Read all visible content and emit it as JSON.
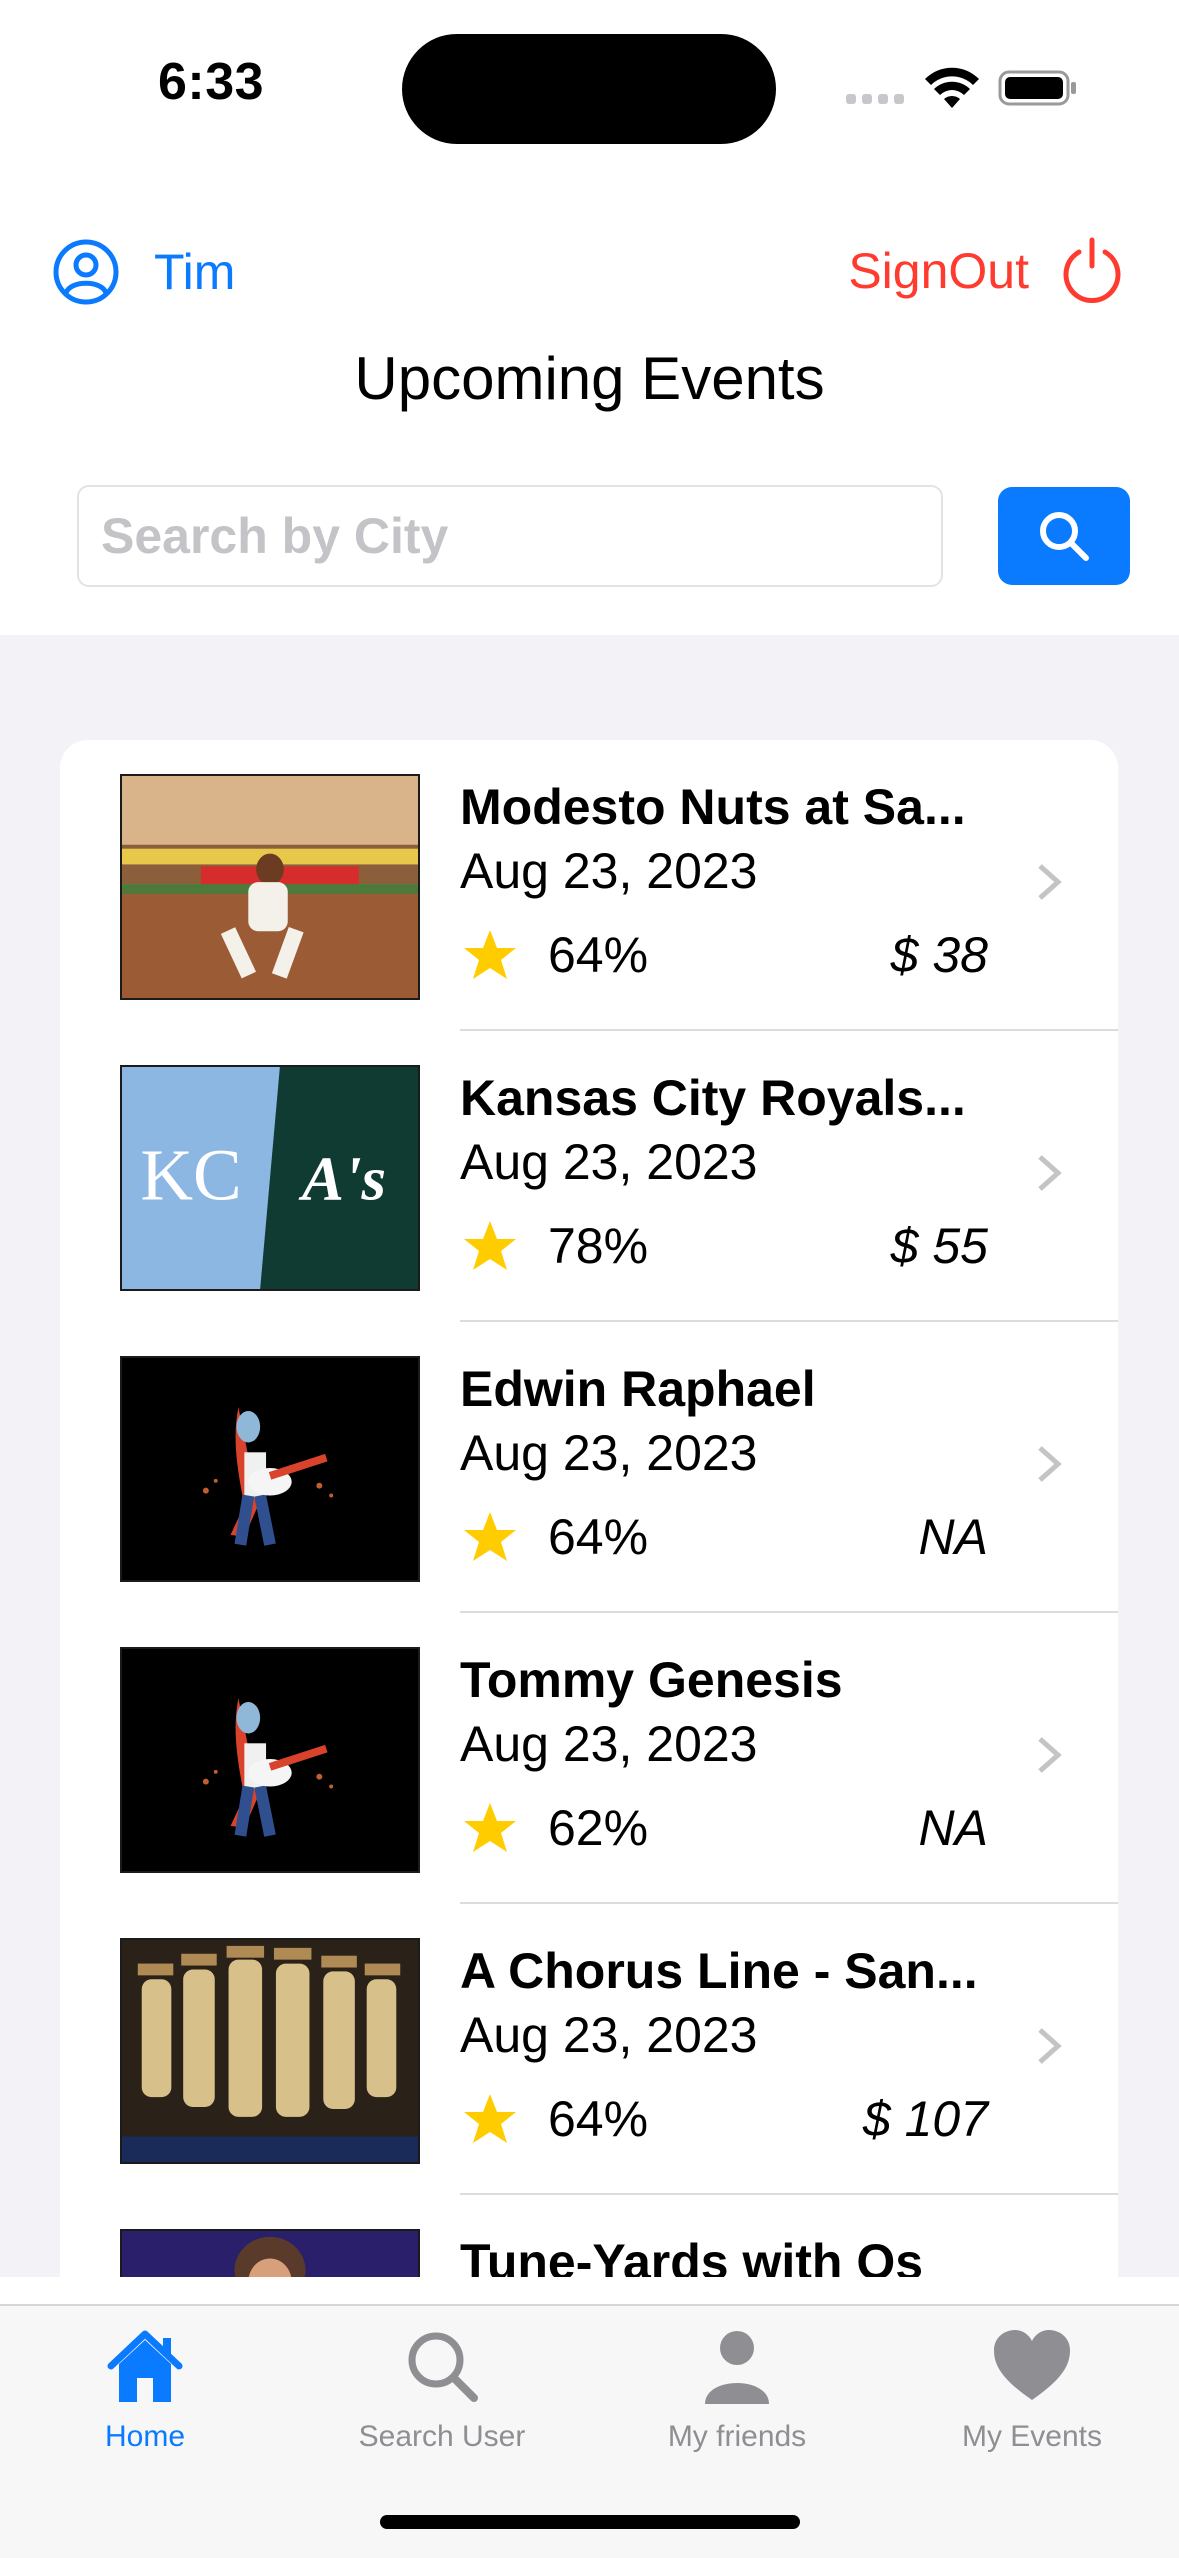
{
  "status_bar": {
    "time": "6:33"
  },
  "header": {
    "user_name": "Tim",
    "signout_label": "SignOut",
    "title": "Upcoming Events"
  },
  "search": {
    "placeholder": "Search by City",
    "value": ""
  },
  "events": [
    {
      "title": "Modesto Nuts at Sa...",
      "date": "Aug 23, 2023",
      "rating": "64%",
      "price": "$ 38",
      "image": "baseball-player-photo"
    },
    {
      "title": "Kansas City Royals...",
      "date": "Aug 23, 2023",
      "rating": "78%",
      "price": "$ 55",
      "image": "kc-royals-vs-athletics-logos"
    },
    {
      "title": "Edwin Raphael",
      "date": "Aug 23, 2023",
      "rating": "64%",
      "price": "NA",
      "image": "guitarist-illustration"
    },
    {
      "title": "Tommy Genesis",
      "date": "Aug 23, 2023",
      "rating": "62%",
      "price": "NA",
      "image": "guitarist-illustration"
    },
    {
      "title": "A Chorus Line - San...",
      "date": "Aug 23, 2023",
      "rating": "64%",
      "price": "$ 107",
      "image": "chorus-line-dancers-photo"
    },
    {
      "title": "Tune-Yards with Os",
      "date": "",
      "rating": "",
      "price": "",
      "image": "concert-photo"
    }
  ],
  "logos": {
    "kc": "KC",
    "athletics": "A's"
  },
  "tabs": [
    {
      "label": "Home",
      "icon": "house-icon",
      "active": true
    },
    {
      "label": "Search User",
      "icon": "magnifier-icon",
      "active": false
    },
    {
      "label": "My friends",
      "icon": "person-icon",
      "active": false
    },
    {
      "label": "My Events",
      "icon": "heart-icon",
      "active": false
    }
  ],
  "colors": {
    "accent": "#0a7aff",
    "signout": "#ff3b30",
    "star": "#ffcc00",
    "list_bg": "#f2f2f7"
  }
}
